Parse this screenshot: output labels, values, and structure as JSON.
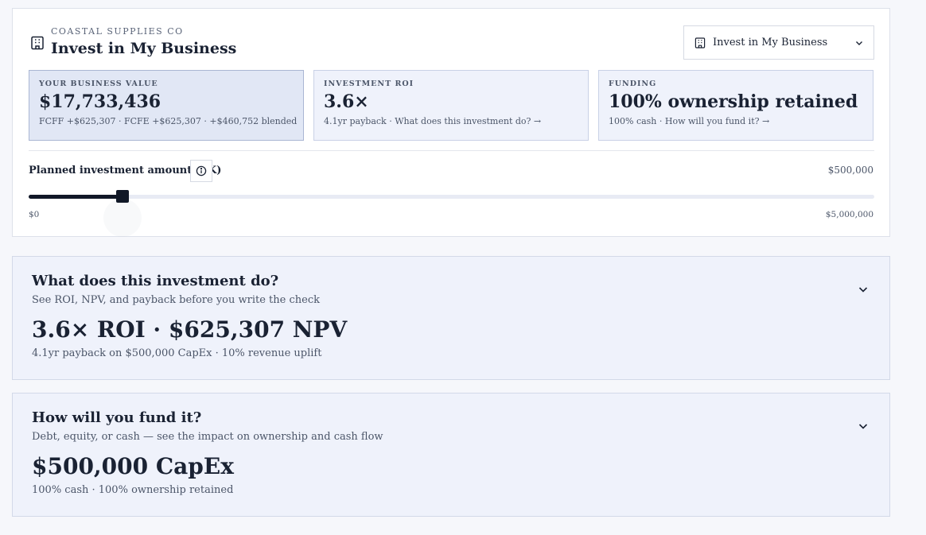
{
  "header": {
    "company": "COASTAL SUPPLIES CO",
    "title": "Invest in My Business",
    "icon": "building-icon"
  },
  "scenario_select": {
    "selected": "Invest in My Business",
    "icon": "building-icon"
  },
  "kpis": [
    {
      "label": "YOUR BUSINESS VALUE",
      "value": "$17,733,436",
      "sub": "FCFF +$625,307 · FCFE +$625,307 · +$460,752 blended",
      "active": true
    },
    {
      "label": "INVESTMENT ROI",
      "value": "3.6×",
      "sub": "4.1yr payback · What does this investment do? →",
      "active": false
    },
    {
      "label": "FUNDING",
      "value": "100% ownership retained",
      "sub": "100% cash · How will you fund it? →",
      "active": false
    }
  ],
  "slider": {
    "label": "Planned investment amount ($K)",
    "value_text": "$500,000",
    "min_label": "$0",
    "max_label": "$5,000,000",
    "fraction": 0.1
  },
  "sections": [
    {
      "title": "What does this investment do?",
      "subtitle": "See ROI, NPV, and payback before you write the check",
      "headline": "3.6× ROI · $625,307 NPV",
      "footnote": "4.1yr payback on $500,000 CapEx · 10% revenue uplift"
    },
    {
      "title": "How will you fund it?",
      "subtitle": "Debt, equity, or cash — see the impact on ownership and cash flow",
      "headline": "$500,000 CapEx",
      "footnote": "100% cash · 100% ownership retained"
    }
  ],
  "colors": {
    "accent": "#111827",
    "panel_bg": "#eff2fb",
    "active_panel_bg": "#e1e7f5"
  }
}
